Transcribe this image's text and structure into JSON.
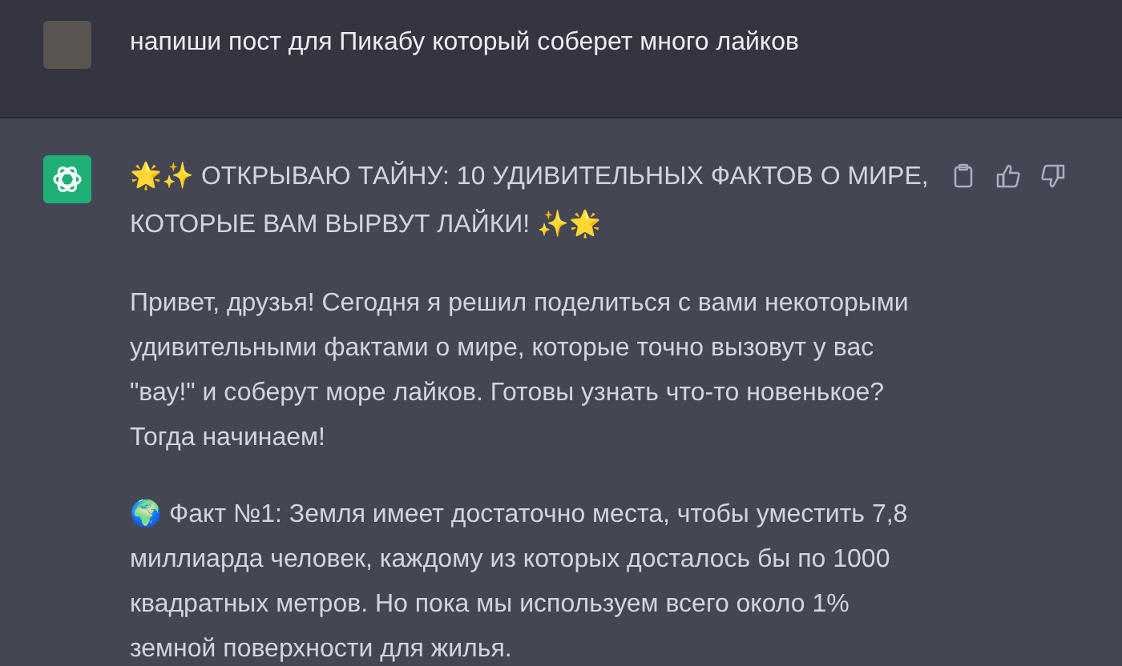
{
  "user_message": {
    "text": "напиши пост для Пикабу который соберет много лайков"
  },
  "assistant_message": {
    "title": "🌟✨ ОТКРЫВАЮ ТАЙНУ: 10 УДИВИТЕЛЬНЫХ ФАКТОВ О МИРЕ, КОТОРЫЕ ВАМ ВЫРВУТ ЛАЙКИ! ✨🌟",
    "paragraphs": [
      {
        "text": "Привет, друзья! Сегодня я решил поделиться с вами некоторыми удивительными фактами о мире, которые точно вызовут у вас \"вау!\" и соберут море лайков. Готовы узнать что-то новенькое? Тогда начинаем!"
      },
      {
        "text": "🌍 Факт №1: Земля имеет достаточно места, чтобы уместить 7,8 миллиарда человек, каждому из которых досталось бы по 1000 квадратных метров. Но пока мы используем всего около 1% земной поверхности для жилья."
      }
    ]
  }
}
